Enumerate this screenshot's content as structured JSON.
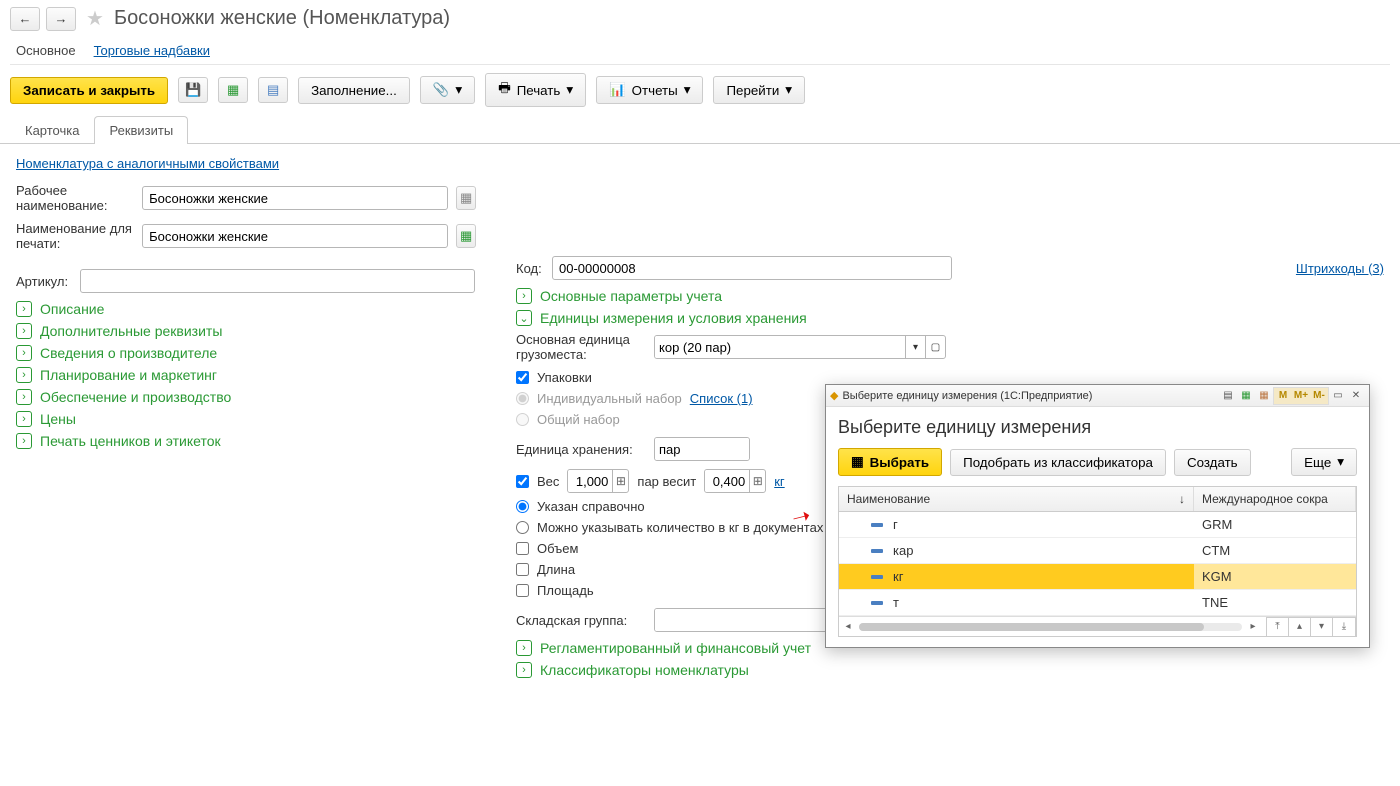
{
  "header": {
    "title": "Босоножки женские (Номенклатура)"
  },
  "subnav": {
    "main": "Основное",
    "markup": "Торговые надбавки"
  },
  "toolbar": {
    "save_close": "Записать и закрыть",
    "fill": "Заполнение...",
    "print": "Печать",
    "reports": "Отчеты",
    "goto": "Перейти"
  },
  "tabs": {
    "card": "Карточка",
    "props": "Реквизиты"
  },
  "links": {
    "similar": "Номенклатура с аналогичными свойствами",
    "barcodes": "Штрихкоды (3)",
    "list": "Список (1)"
  },
  "fields": {
    "work_name_label": "Рабочее наименование:",
    "work_name": "Босоножки женские",
    "print_name_label": "Наименование для печати:",
    "print_name": "Босоножки женские",
    "article_label": "Артикул:",
    "code_label": "Код:",
    "code": "00-00000008",
    "main_unit_label": "Основная единица грузоместа:",
    "main_unit": "кор (20 пар)",
    "packs": "Упаковки",
    "indiv_set": "Индивидуальный набор",
    "common_set": "Общий набор",
    "storage_unit_label": "Единица хранения:",
    "storage_unit": "пар",
    "weight": "Вес",
    "weight_qty": "1,000",
    "weight_mid": "пар весит",
    "weight_val": "0,400",
    "weight_unit": "кг",
    "ref_specified": "Указан справочно",
    "can_qty_kg": "Можно указывать количество в кг в документах",
    "volume": "Объем",
    "length": "Длина",
    "area": "Площадь",
    "warehouse_group_label": "Складская группа:"
  },
  "sections": {
    "desc": "Описание",
    "extra": "Дополнительные реквизиты",
    "manuf": "Сведения о производителе",
    "plan": "Планирование и маркетинг",
    "supply": "Обеспечение и производство",
    "prices": "Цены",
    "print_tags": "Печать ценников и этикеток",
    "main_params": "Основные параметры учета",
    "units_storage": "Единицы измерения и условия хранения",
    "regl": "Регламентированный и финансовый учет",
    "classifiers": "Классификаторы номенклатуры"
  },
  "modal": {
    "window_title": "Выберите единицу измерения  (1С:Предприятие)",
    "heading": "Выберите единицу измерения",
    "select": "Выбрать",
    "pick_class": "Подобрать из классификатора",
    "create": "Создать",
    "more": "Еще",
    "col_name": "Наименование",
    "col_intl": "Международное сокра",
    "m": "M",
    "mplus": "M+",
    "mminus": "M-",
    "rows": [
      {
        "name": "г",
        "intl": "GRM"
      },
      {
        "name": "кар",
        "intl": "CTM"
      },
      {
        "name": "кг",
        "intl": "KGM"
      },
      {
        "name": "т",
        "intl": "TNE"
      }
    ]
  }
}
